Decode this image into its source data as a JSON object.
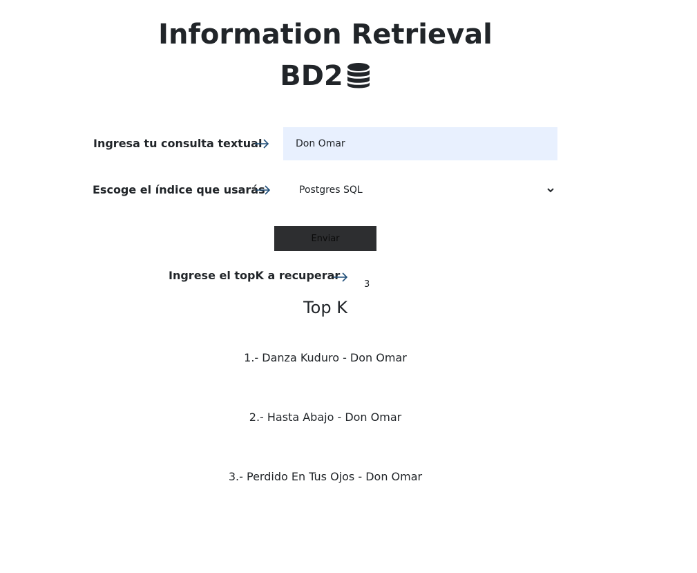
{
  "header": {
    "title": "Information Retrieval",
    "subtitle": "BD2",
    "subtitle_icon": "database-icon"
  },
  "query_form": {
    "text_label": "Ingresa tu consulta textual",
    "text_value": "Don Omar",
    "index_label": "Escoge el índice que usarás",
    "index_selected": "Postgres SQL",
    "submit_label": "Enviar",
    "topk_label": "Ingrese el topK a recuperar",
    "topk_value": "3",
    "arrow_icon": "arrow-right-icon",
    "arrow_color": "#1f4e79"
  },
  "results": {
    "heading": "Top K",
    "items": [
      "1.- Danza Kuduro - Don Omar",
      "2.- Hasta Abajo - Don Omar",
      "3.- Perdido En Tus Ojos - Don Omar"
    ]
  },
  "colors": {
    "input_bg": "#e8f0fe",
    "button_bg": "#2d2e30",
    "text": "#212529"
  }
}
